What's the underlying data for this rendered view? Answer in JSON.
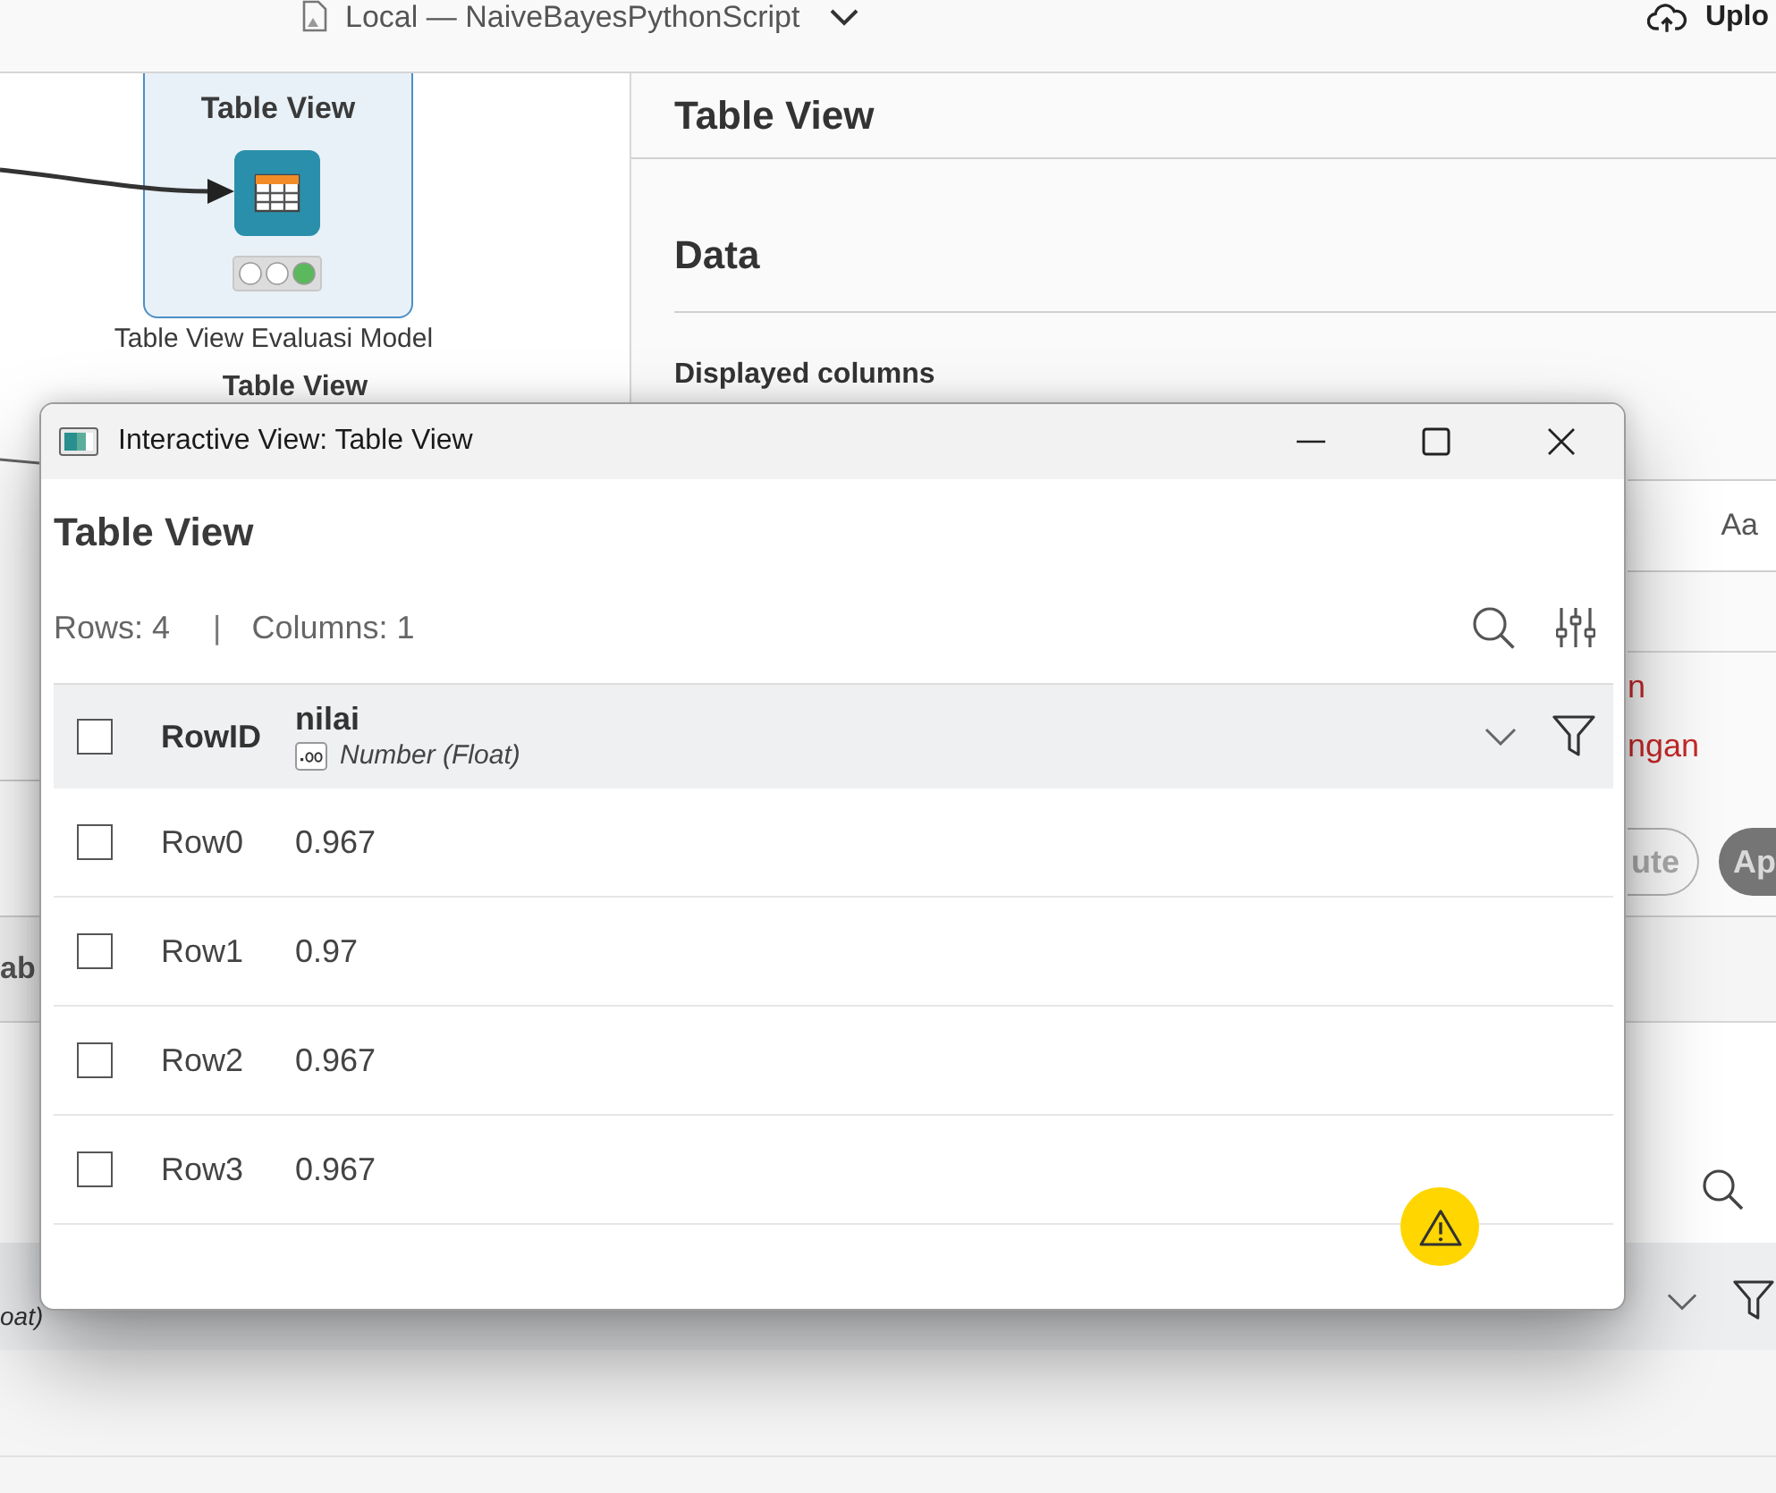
{
  "app_bar": {
    "workflow_title": "Local — NaiveBayesPythonScript",
    "upload_label": "Uplo"
  },
  "canvas": {
    "node": {
      "title": "Table View",
      "lights": [
        {
          "on": false
        },
        {
          "on": false
        },
        {
          "on": true
        }
      ],
      "label": "Table View Evaluasi Model"
    },
    "next_node_title": "Table View"
  },
  "side_panel": {
    "title": "Table View",
    "section": "Data",
    "field_label": "Displayed columns",
    "case_toggle": "Aa",
    "error_lines": [
      "n",
      "ngan"
    ],
    "buttons": [
      {
        "label": "ute",
        "kind": "outline"
      },
      {
        "label": "Ap",
        "kind": "filled"
      }
    ]
  },
  "output_panel": {
    "tab_label": "ab",
    "column_type": "oat)"
  },
  "dialog": {
    "title": "Interactive View: Table View",
    "heading": "Table View",
    "rows_count": "Rows: 4",
    "separator": "|",
    "columns_count": "Columns: 1",
    "table": {
      "select_all_checked": false,
      "id_column": "RowID",
      "columns": [
        {
          "name": "nilai",
          "type": "Number (Float)"
        }
      ],
      "rows": [
        {
          "id": "Row0",
          "values": [
            "0.967"
          ],
          "selected": false
        },
        {
          "id": "Row1",
          "values": [
            "0.97"
          ],
          "selected": false
        },
        {
          "id": "Row2",
          "values": [
            "0.967"
          ],
          "selected": false
        },
        {
          "id": "Row3",
          "values": [
            "0.967"
          ],
          "selected": false
        }
      ]
    }
  }
}
